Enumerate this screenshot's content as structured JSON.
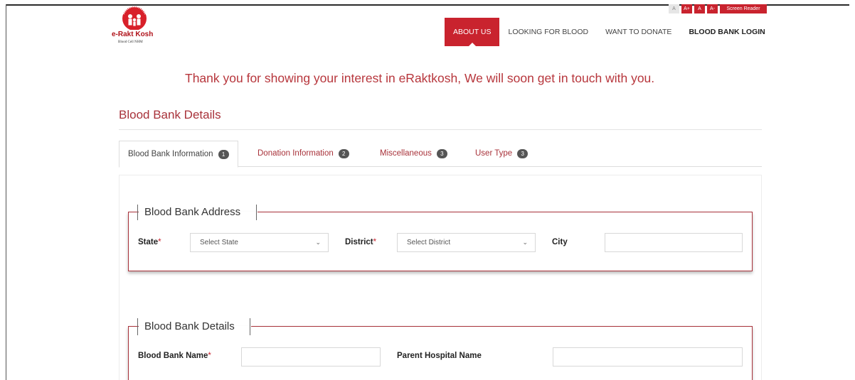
{
  "brand": {
    "name": "e-Rakt Kosh",
    "subtitle": "Blood Cell NHM",
    "colors": {
      "primary": "#c9232e",
      "accent_text": "#a8323a"
    }
  },
  "utility_bar": {
    "buttons": [
      "A",
      "A+",
      "A",
      "A-",
      "Screen Reader"
    ]
  },
  "nav": {
    "items": [
      "ABOUT US",
      "LOOKING FOR BLOOD",
      "WANT TO DONATE",
      "BLOOD BANK LOGIN"
    ]
  },
  "message": "Thank you for showing your interest in eRaktkosh, We will soon get in touch with you.",
  "page_title": "Blood Bank Details",
  "tabs": [
    {
      "label": "Blood Bank Information",
      "badge": "1"
    },
    {
      "label": "Donation Information",
      "badge": "2"
    },
    {
      "label": "Miscellaneous",
      "badge": "3"
    },
    {
      "label": "User Type",
      "badge": "3"
    }
  ],
  "address_section": {
    "legend": "Blood Bank Address",
    "state_label": "State",
    "state_placeholder": "Select State",
    "district_label": "District",
    "district_placeholder": "Select District",
    "city_label": "City",
    "city_value": "",
    "required_mark": "*"
  },
  "details_section": {
    "legend": "Blood Bank Details",
    "name_label": "Blood Bank Name",
    "name_value": "",
    "parent_label": "Parent Hospital Name",
    "parent_value": "",
    "required_mark": "*"
  },
  "icons": {
    "dropdown": "chevron-down-icon",
    "logo": "erakt-kosh-logo"
  }
}
